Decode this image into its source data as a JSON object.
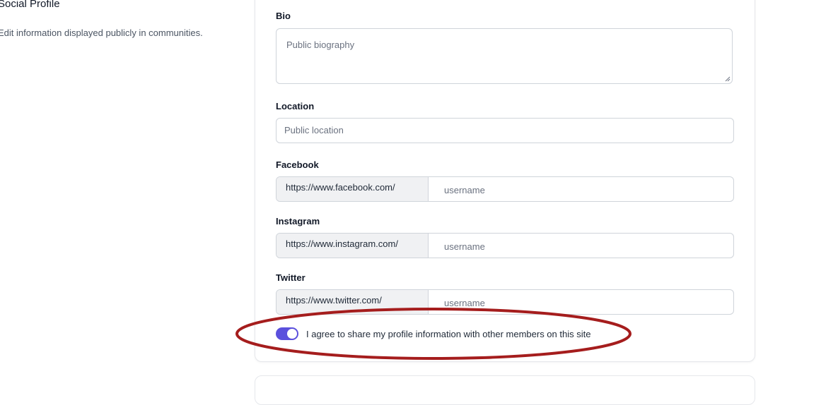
{
  "section": {
    "title": "Social Profile",
    "description": "Edit information displayed publicly in communities."
  },
  "form": {
    "bio": {
      "label": "Bio",
      "placeholder": "Public biography"
    },
    "location": {
      "label": "Location",
      "placeholder": "Public location"
    },
    "facebook": {
      "label": "Facebook",
      "prefix": "https://www.facebook.com/",
      "placeholder": "username"
    },
    "instagram": {
      "label": "Instagram",
      "prefix": "https://www.instagram.com/",
      "placeholder": "username"
    },
    "twitter": {
      "label": "Twitter",
      "prefix": "https://www.twitter.com/",
      "placeholder": "username"
    },
    "consent": {
      "label": "I agree to share my profile information with other members on this site",
      "checked": true
    }
  },
  "colors": {
    "accent": "#5b50dd",
    "annotation": "#a51d1d"
  }
}
